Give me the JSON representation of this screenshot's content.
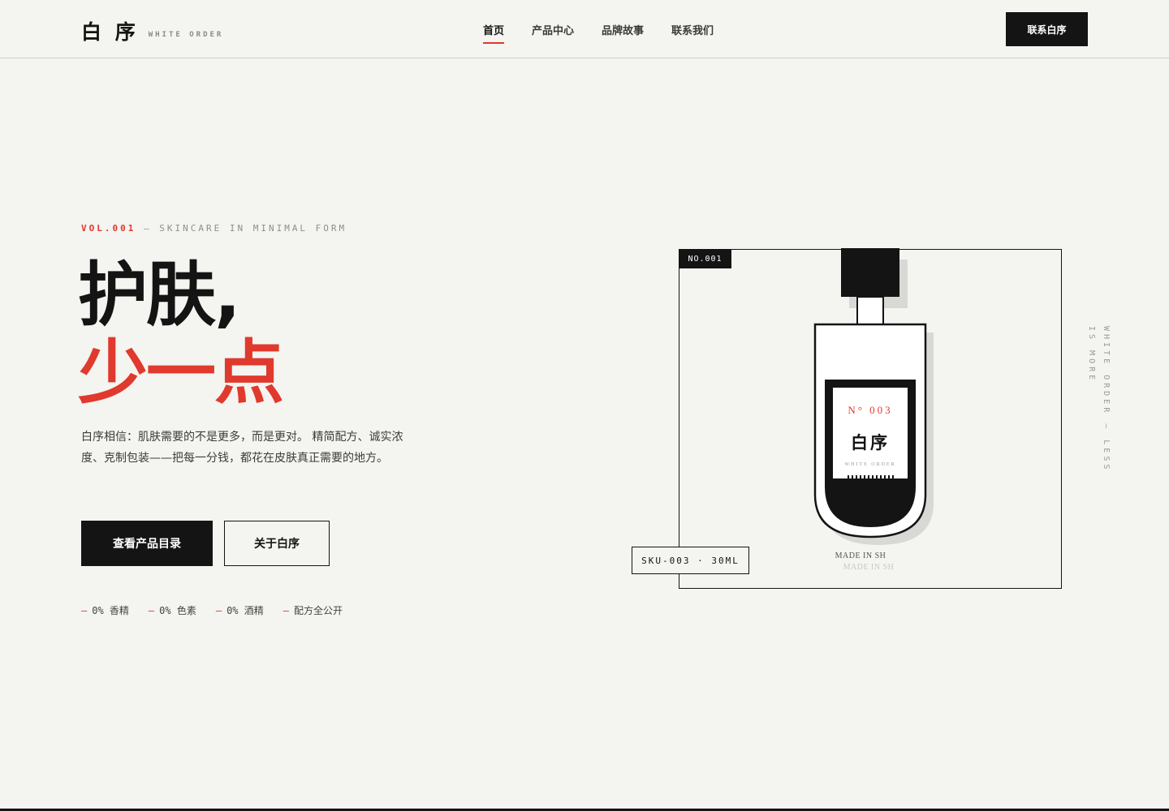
{
  "header": {
    "logo_cn": "白 序",
    "logo_en": "WHITE ORDER",
    "nav": [
      {
        "label": "首页",
        "active": true
      },
      {
        "label": "产品中心",
        "active": false
      },
      {
        "label": "品牌故事",
        "active": false
      },
      {
        "label": "联系我们",
        "active": false
      }
    ],
    "contact_label": "联系白序"
  },
  "hero": {
    "eyebrow_accent": "VOL.001",
    "eyebrow_rest": "— SKINCARE IN MINIMAL FORM",
    "headline_line1": "护肤,",
    "headline_line2": "少一点",
    "description": "白序相信：肌肤需要的不是更多，而是更对。 精简配方、诚实浓度、克制包装——把每一分钱，都花在皮肤真正需要的地方。",
    "primary_button": "查看产品目录",
    "secondary_button": "关于白序",
    "features": [
      "0% 香精",
      "0% 色素",
      "0% 酒精",
      "配方全公开"
    ]
  },
  "product": {
    "tag": "NO.001",
    "sku": "SKU-003 · 30ML",
    "label_number": "N° 003",
    "label_brand": "白序",
    "label_en": "WHITE ORDER",
    "made_in": "MADE IN SH",
    "made_in_shadow": "MADE IN SH"
  },
  "vertical_text": {
    "line_a": "WHITE ORDER — LESS",
    "line_b": "IS MORE"
  },
  "colors": {
    "background": "#f4f4f0",
    "ink": "#141414",
    "accent": "#e0392d"
  }
}
